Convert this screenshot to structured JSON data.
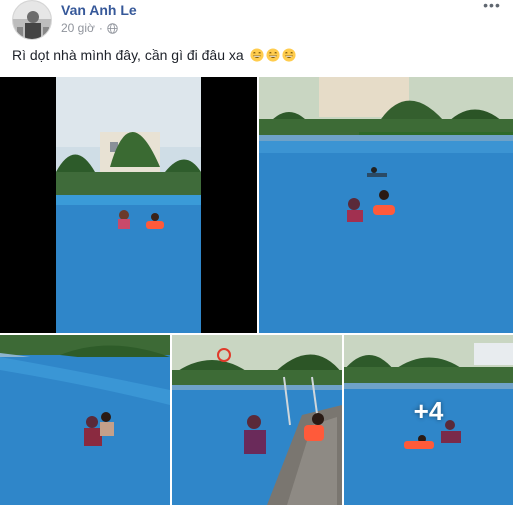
{
  "post": {
    "author": "Van Anh Le",
    "time": "20 giờ",
    "text": "Rì dọt nhà mình đây, cần gì đi đâu xa",
    "emojis": [
      "grinning-face-emoji",
      "grinning-face-emoji",
      "grinning-face-emoji"
    ],
    "more_label": "•••"
  },
  "photos": {
    "more_count_label": "+4",
    "items": [
      {
        "description_icon": "photo-1-child-and-mother-in-pool-with-palms"
      },
      {
        "description_icon": "photo-2-mother-and-child-swimming"
      },
      {
        "description_icon": "photo-3-mother-holding-child-in-pool"
      },
      {
        "description_icon": "photo-4-mother-and-child-by-pool-ladder"
      },
      {
        "description_icon": "photo-5-mother-and-child-in-pool"
      }
    ]
  },
  "colors": {
    "author_link": "#365899",
    "meta_text": "#90949c",
    "body_text": "#1d2129",
    "pool_water": "#2f86c9"
  }
}
